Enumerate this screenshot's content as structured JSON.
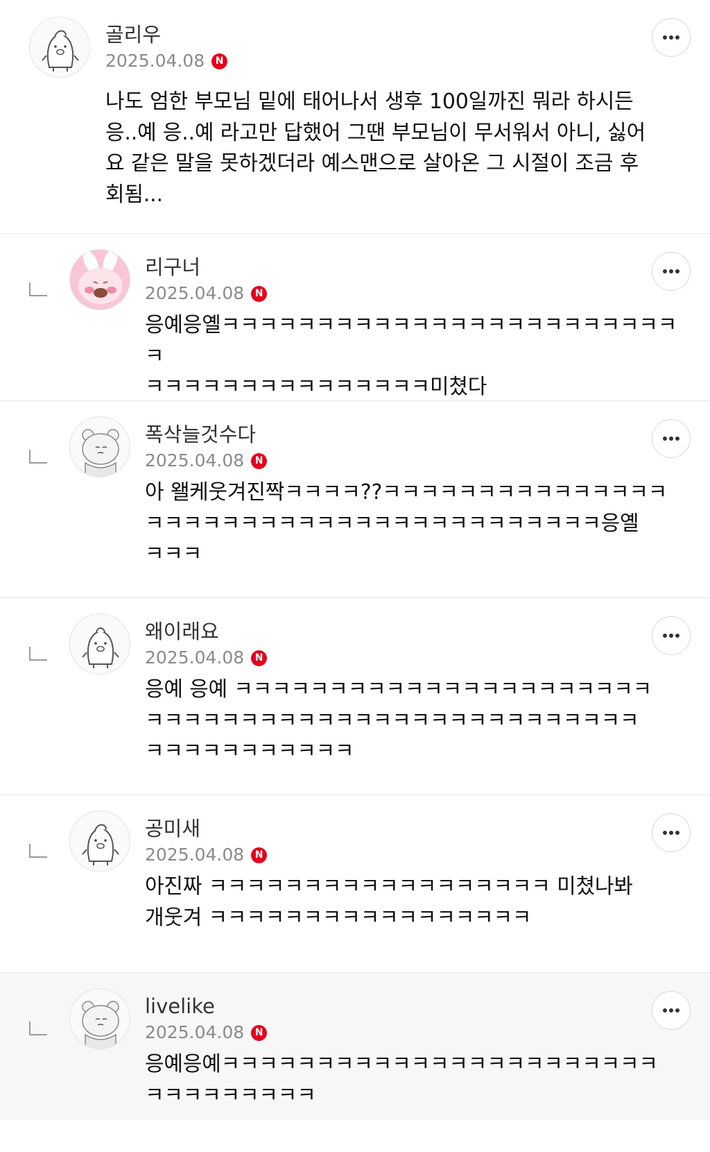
{
  "comments": [
    {
      "nickname": "골리우",
      "date": "2025.04.08",
      "badge": "N",
      "text": "나도 엄한 부모님 밑에 태어나서 생후 100일까진 뭐라 하시든\n응..예 응..예 라고만 답했어 그땐 부모님이 무서워서 아니, 싫어\n요 같은 말을 못하겠더라 예스맨으로 살아온 그 시절이 조금 후\n회됨...",
      "avatar_icon": "penguin-avatar-icon"
    },
    {
      "nickname": "리구너",
      "date": "2025.04.08",
      "badge": "N",
      "text": "응예응옐ㅋㅋㅋㅋㅋㅋㅋㅋㅋㅋㅋㅋㅋㅋㅋㅋㅋㅋㅋㅋㅋㅋㅋㅋㅋ\nㅋㅋㅋㅋㅋㅋㅋㅋㅋㅋㅋㅋㅋㅋㅋ미쳤다",
      "avatar_icon": "pink-bunny-avatar-icon"
    },
    {
      "nickname": "폭삭늘것수다",
      "date": "2025.04.08",
      "badge": "N",
      "text": "아 왤케웃겨진짝ㅋㅋㅋㅋ??ㅋㅋㅋㅋㅋㅋㅋㅋㅋㅋㅋㅋㅋㅋㅋ\nㅋㅋㅋㅋㅋㅋㅋㅋㅋㅋㅋㅋㅋㅋㅋㅋㅋㅋㅋㅋㅋㅋㅋㅋ응옐\nㅋㅋㅋ",
      "avatar_icon": "bear-avatar-icon"
    },
    {
      "nickname": "왜이래요",
      "date": "2025.04.08",
      "badge": "N",
      "text": "응예 응예 ㅋㅋㅋㅋㅋㅋㅋㅋㅋㅋㅋㅋㅋㅋㅋㅋㅋㅋㅋㅋㅋㅋ\nㅋㅋㅋㅋㅋㅋㅋㅋㅋㅋㅋㅋㅋㅋㅋㅋㅋㅋㅋㅋㅋㅋㅋㅋㅋㅋ\nㅋㅋㅋㅋㅋㅋㅋㅋㅋㅋㅋ",
      "avatar_icon": "penguin-avatar-icon"
    },
    {
      "nickname": "공미새",
      "date": "2025.04.08",
      "badge": "N",
      "text": "아진짜 ㅋㅋㅋㅋㅋㅋㅋㅋㅋㅋㅋㅋㅋㅋㅋㅋㅋㅋ 미쳤나봐\n개웃겨 ㅋㅋㅋㅋㅋㅋㅋㅋㅋㅋㅋㅋㅋㅋㅋㅋㅋ",
      "avatar_icon": "penguin-avatar-icon"
    },
    {
      "nickname": "livelike",
      "date": "2025.04.08",
      "badge": "N",
      "text": "응예응예ㅋㅋㅋㅋㅋㅋㅋㅋㅋㅋㅋㅋㅋㅋㅋㅋㅋㅋㅋㅋㅋㅋㅋ\nㅋㅋㅋㅋㅋㅋㅋㅋㅋ",
      "avatar_icon": "bear-avatar-icon"
    }
  ],
  "more_icon": "more-options-icon",
  "colors": {
    "badge": "#e3001b",
    "divider": "#e6e6e6",
    "date": "#8a8a8a"
  }
}
